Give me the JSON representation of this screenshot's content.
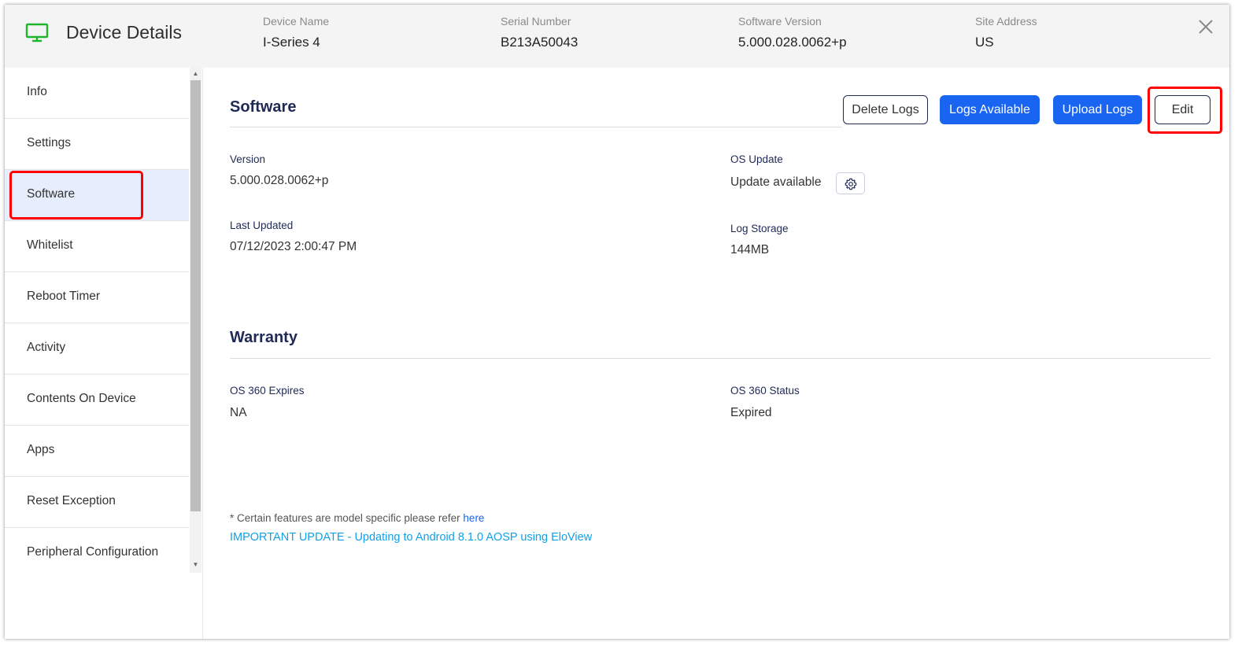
{
  "header": {
    "title": "Device Details",
    "fields": [
      {
        "label": "Device Name",
        "value": "I-Series 4"
      },
      {
        "label": "Serial Number",
        "value": "B213A50043"
      },
      {
        "label": "Software Version",
        "value": "5.000.028.0062+p"
      },
      {
        "label": "Site Address",
        "value": "US"
      }
    ]
  },
  "sidebar": {
    "items": [
      {
        "label": "Info"
      },
      {
        "label": "Settings"
      },
      {
        "label": "Software",
        "active": true
      },
      {
        "label": "Whitelist"
      },
      {
        "label": "Reboot Timer"
      },
      {
        "label": "Activity"
      },
      {
        "label": "Contents On Device"
      },
      {
        "label": "Apps"
      },
      {
        "label": "Reset Exception"
      },
      {
        "label": "Peripheral Configuration"
      }
    ]
  },
  "software": {
    "title": "Software",
    "buttons": {
      "delete_logs": "Delete Logs",
      "logs_available": "Logs Available",
      "upload_logs": "Upload Logs",
      "edit": "Edit"
    },
    "version_label": "Version",
    "version_value": "5.000.028.0062+p",
    "os_update_label": "OS Update",
    "os_update_value": "Update available",
    "last_updated_label": "Last Updated",
    "last_updated_value": "07/12/2023 2:00:47 PM",
    "log_storage_label": "Log Storage",
    "log_storage_value": "144MB"
  },
  "warranty": {
    "title": "Warranty",
    "expires_label": "OS 360 Expires",
    "expires_value": "NA",
    "status_label": "OS 360 Status",
    "status_value": "Expired"
  },
  "footer": {
    "note": "* Certain features are model specific please refer",
    "note_link": "here",
    "important_link": "IMPORTANT UPDATE - Updating to Android 8.1.0 AOSP using EloView"
  },
  "colors": {
    "accent": "#1a64f2",
    "navy": "#1e2a55",
    "highlight": "#ff0000",
    "device_icon": "#1fb52b",
    "important_link": "#11a1e8"
  },
  "icons": {
    "device": "monitor-icon",
    "close": "close-icon",
    "settings": "gear-icon"
  }
}
